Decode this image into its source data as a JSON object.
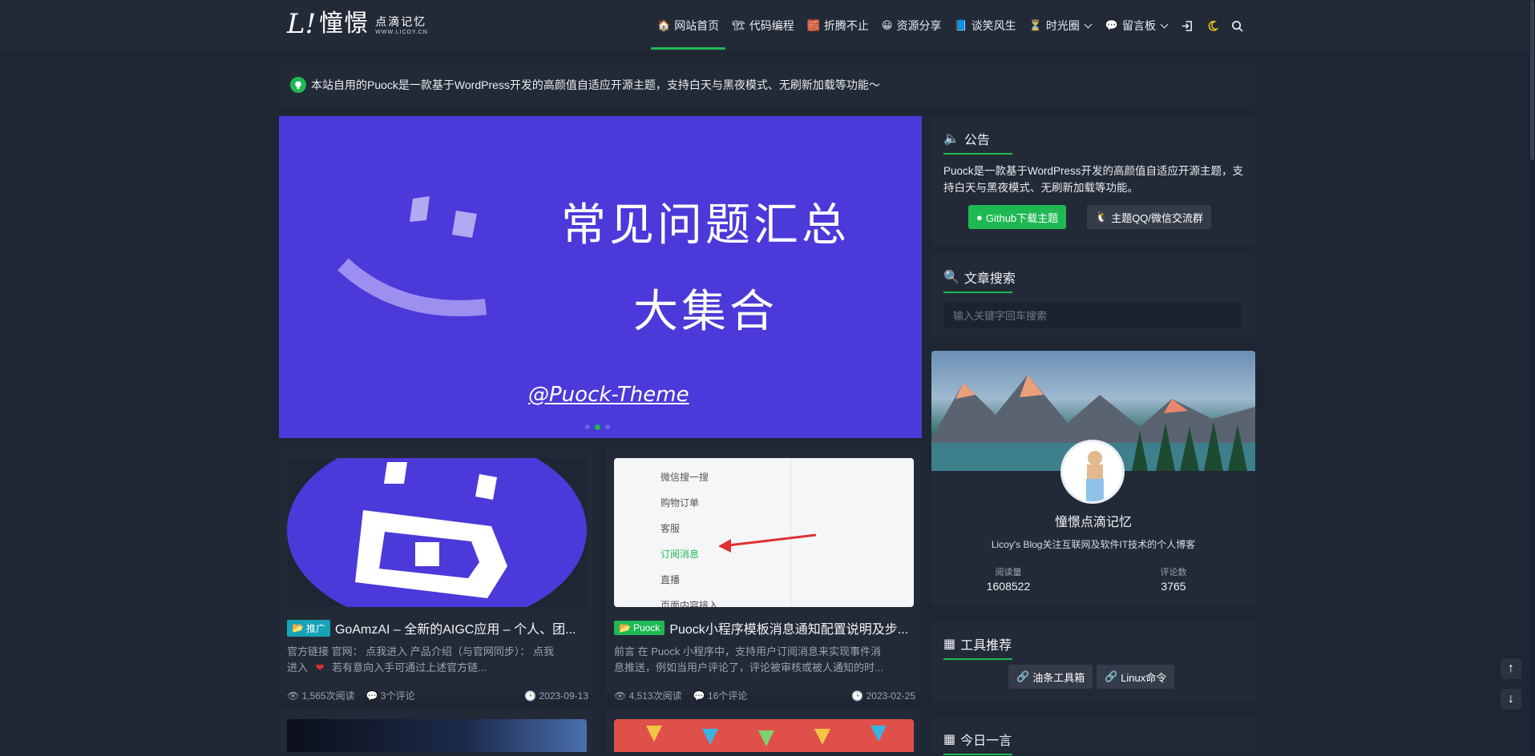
{
  "header": {
    "logo_mark": "L!",
    "logo_cn": "憧憬",
    "logo_sub_cn": "点滴记忆",
    "logo_sub_en": "WWW.LICOY.CN",
    "nav": [
      {
        "label": "网站首页",
        "icon": "🏠",
        "active": true
      },
      {
        "label": "代码编程",
        "icon": "🏗",
        "active": false
      },
      {
        "label": "折腾不止",
        "icon": "🧱",
        "active": false
      },
      {
        "label": "资源分享",
        "icon": "😀",
        "active": false
      },
      {
        "label": "谈笑风生",
        "icon": "📘",
        "active": false
      },
      {
        "label": "时光圈",
        "icon": "⏳",
        "active": false,
        "dropdown": true
      },
      {
        "label": "留言板",
        "icon": "💬",
        "active": false,
        "dropdown": true
      }
    ],
    "icons": {
      "login": "login-icon",
      "theme": "moon-icon",
      "search": "search-icon"
    }
  },
  "notice": {
    "text": "本站自用的Puock是一款基于WordPress开发的高颜值自适应开源主题，支持白天与黑夜模式、无刷新加载等功能～"
  },
  "carousel": {
    "title_line1": "常见问题汇总",
    "title_line2": "大集合",
    "handle": "@Puock-Theme",
    "slides": 3,
    "active_slide": 2
  },
  "posts": [
    {
      "tag": "推广",
      "tag_color": "#17a2b8",
      "title": "GoAmzAI – 全新的AIGC应用 – 个人、团...",
      "desc_line1": "官方链接 官网： 点我进入 产品介绍（与官网同步）： 点我",
      "desc_line2_a": "进入",
      "desc_line2_b": "若有意向入手可通过上述官方链...",
      "views": "1,565次阅读",
      "comments": "3个评论",
      "date": "2023-09-13"
    },
    {
      "tag": "Puock",
      "tag_color": "#1fb954",
      "title": "Puock小程序模板消息通知配置说明及步...",
      "desc_line1": "前言 在 Puock 小程序中，支持用户订阅消息来实现事件消",
      "desc_line2_a": "息推送，例如当用户评论了，评论被审核或被人通知的时...",
      "desc_line2_b": "",
      "views": "4,513次阅读",
      "comments": "16个评论",
      "date": "2023-02-25",
      "thumb_menu": [
        "微信搜一搜",
        "购物订单",
        "客服",
        "订阅消息",
        "直播",
        "页面内容接入"
      ]
    }
  ],
  "sidebar": {
    "announcement": {
      "title": "公告",
      "text": "Puock是一款基于WordPress开发的高颜值自适应开源主题，支持白天与黑夜模式、无刷新加载等功能。",
      "btn_github": "Github下载主题",
      "btn_qq": "主题QQ/微信交流群"
    },
    "search": {
      "title": "文章搜索",
      "placeholder": "输入关键字回车搜索"
    },
    "profile": {
      "name": "憧憬点滴记忆",
      "bio": "Licoy's Blog关注互联网及软件IT技术的个人博客",
      "reads_label": "阅读量",
      "reads": "1608522",
      "comments_label": "评论数",
      "comments": "3765"
    },
    "tools": {
      "title": "工具推荐",
      "items": [
        "油条工具箱",
        "Linux命令"
      ]
    },
    "daily": {
      "title": "今日一言"
    }
  },
  "colors": {
    "accent": "#1fb954",
    "background": "#1e2634",
    "panel": "#232a37",
    "carousel": "#4b3ad9"
  }
}
